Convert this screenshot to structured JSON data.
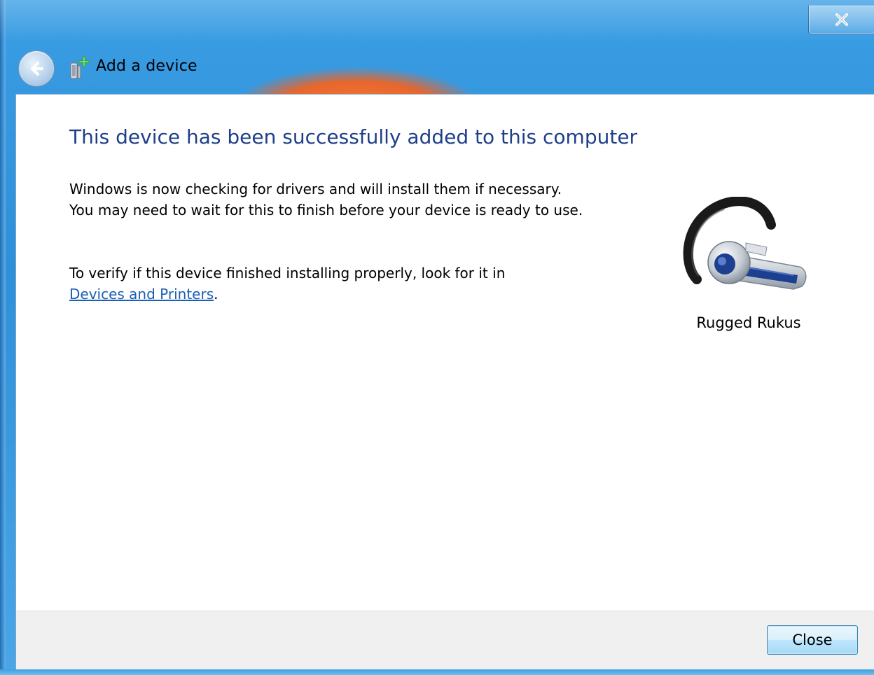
{
  "window": {
    "title": "Add a device",
    "close_icon": "close-x-icon",
    "back_icon": "back-arrow-icon",
    "title_icon": "add-device-icon",
    "accent_color": "#2f8fd8"
  },
  "main": {
    "heading": "This device has been successfully added to this computer",
    "paragraph1": "Windows is now checking for drivers and will install them if necessary. You may need to wait for this to finish before your device is ready to use.",
    "paragraph2_prefix": "To verify if this device finished installing properly, look for it in",
    "paragraph2_link": "Devices and Printers",
    "paragraph2_suffix": ".",
    "heading_color": "#1e3f8a",
    "link_color": "#1a5fb4"
  },
  "device": {
    "name": "Rugged Rukus",
    "icon": "bluetooth-headset-icon"
  },
  "footer": {
    "close_label": "Close"
  }
}
